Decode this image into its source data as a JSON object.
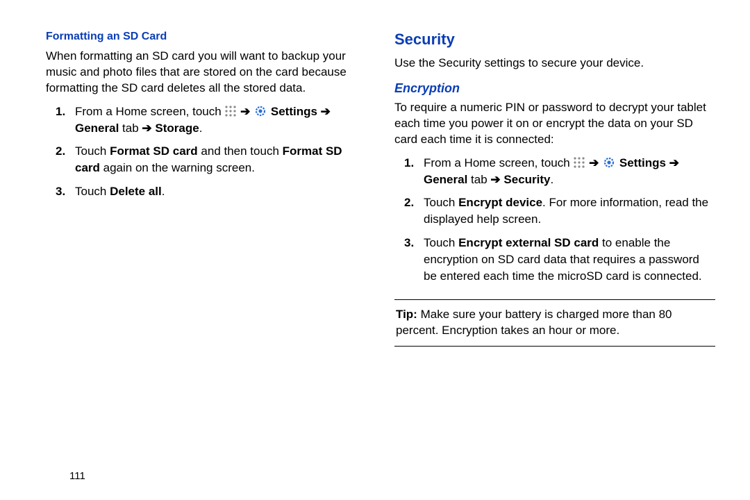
{
  "left": {
    "heading": "Formatting an SD Card",
    "intro": "When formatting an SD card you will want to backup your music and photo files that are stored on the card because formatting the SD card deletes all the stored data.",
    "step1": {
      "pre_text": "From a Home screen, touch ",
      "settings_label": "Settings",
      "general_tab": "General",
      "tab_word": "tab",
      "storage_label": "Storage"
    },
    "step2": {
      "pre": "Touch ",
      "b1": "Format SD card",
      "mid": " and then touch ",
      "b2": "Format SD card",
      "post": " again on the warning screen."
    },
    "step3": {
      "pre": "Touch ",
      "b1": "Delete all",
      "post": "."
    }
  },
  "right": {
    "security_heading": "Security",
    "security_intro": "Use the Security settings to secure your device.",
    "encryption_heading": "Encryption",
    "encryption_intro": "To require a numeric PIN or password to decrypt your tablet each time you power it on or encrypt the data on your SD card each time it is connected:",
    "step1": {
      "pre_text": "From a Home screen, touch ",
      "settings_label": "Settings",
      "general_tab": "General",
      "tab_word": "tab",
      "security_label": "Security"
    },
    "step2": {
      "pre": "Touch ",
      "b1": "Encrypt device",
      "post": ". For more information, read the displayed help screen."
    },
    "step3": {
      "pre": "Touch ",
      "b1": "Encrypt external SD card",
      "post": " to enable the encryption on SD card data that requires a password be entered each time the microSD card is connected."
    },
    "tip_label": "Tip:",
    "tip_text": " Make sure your battery is charged more than 80 percent. Encryption takes an hour or more."
  },
  "page_number": "111",
  "arrow_glyph": "➔"
}
